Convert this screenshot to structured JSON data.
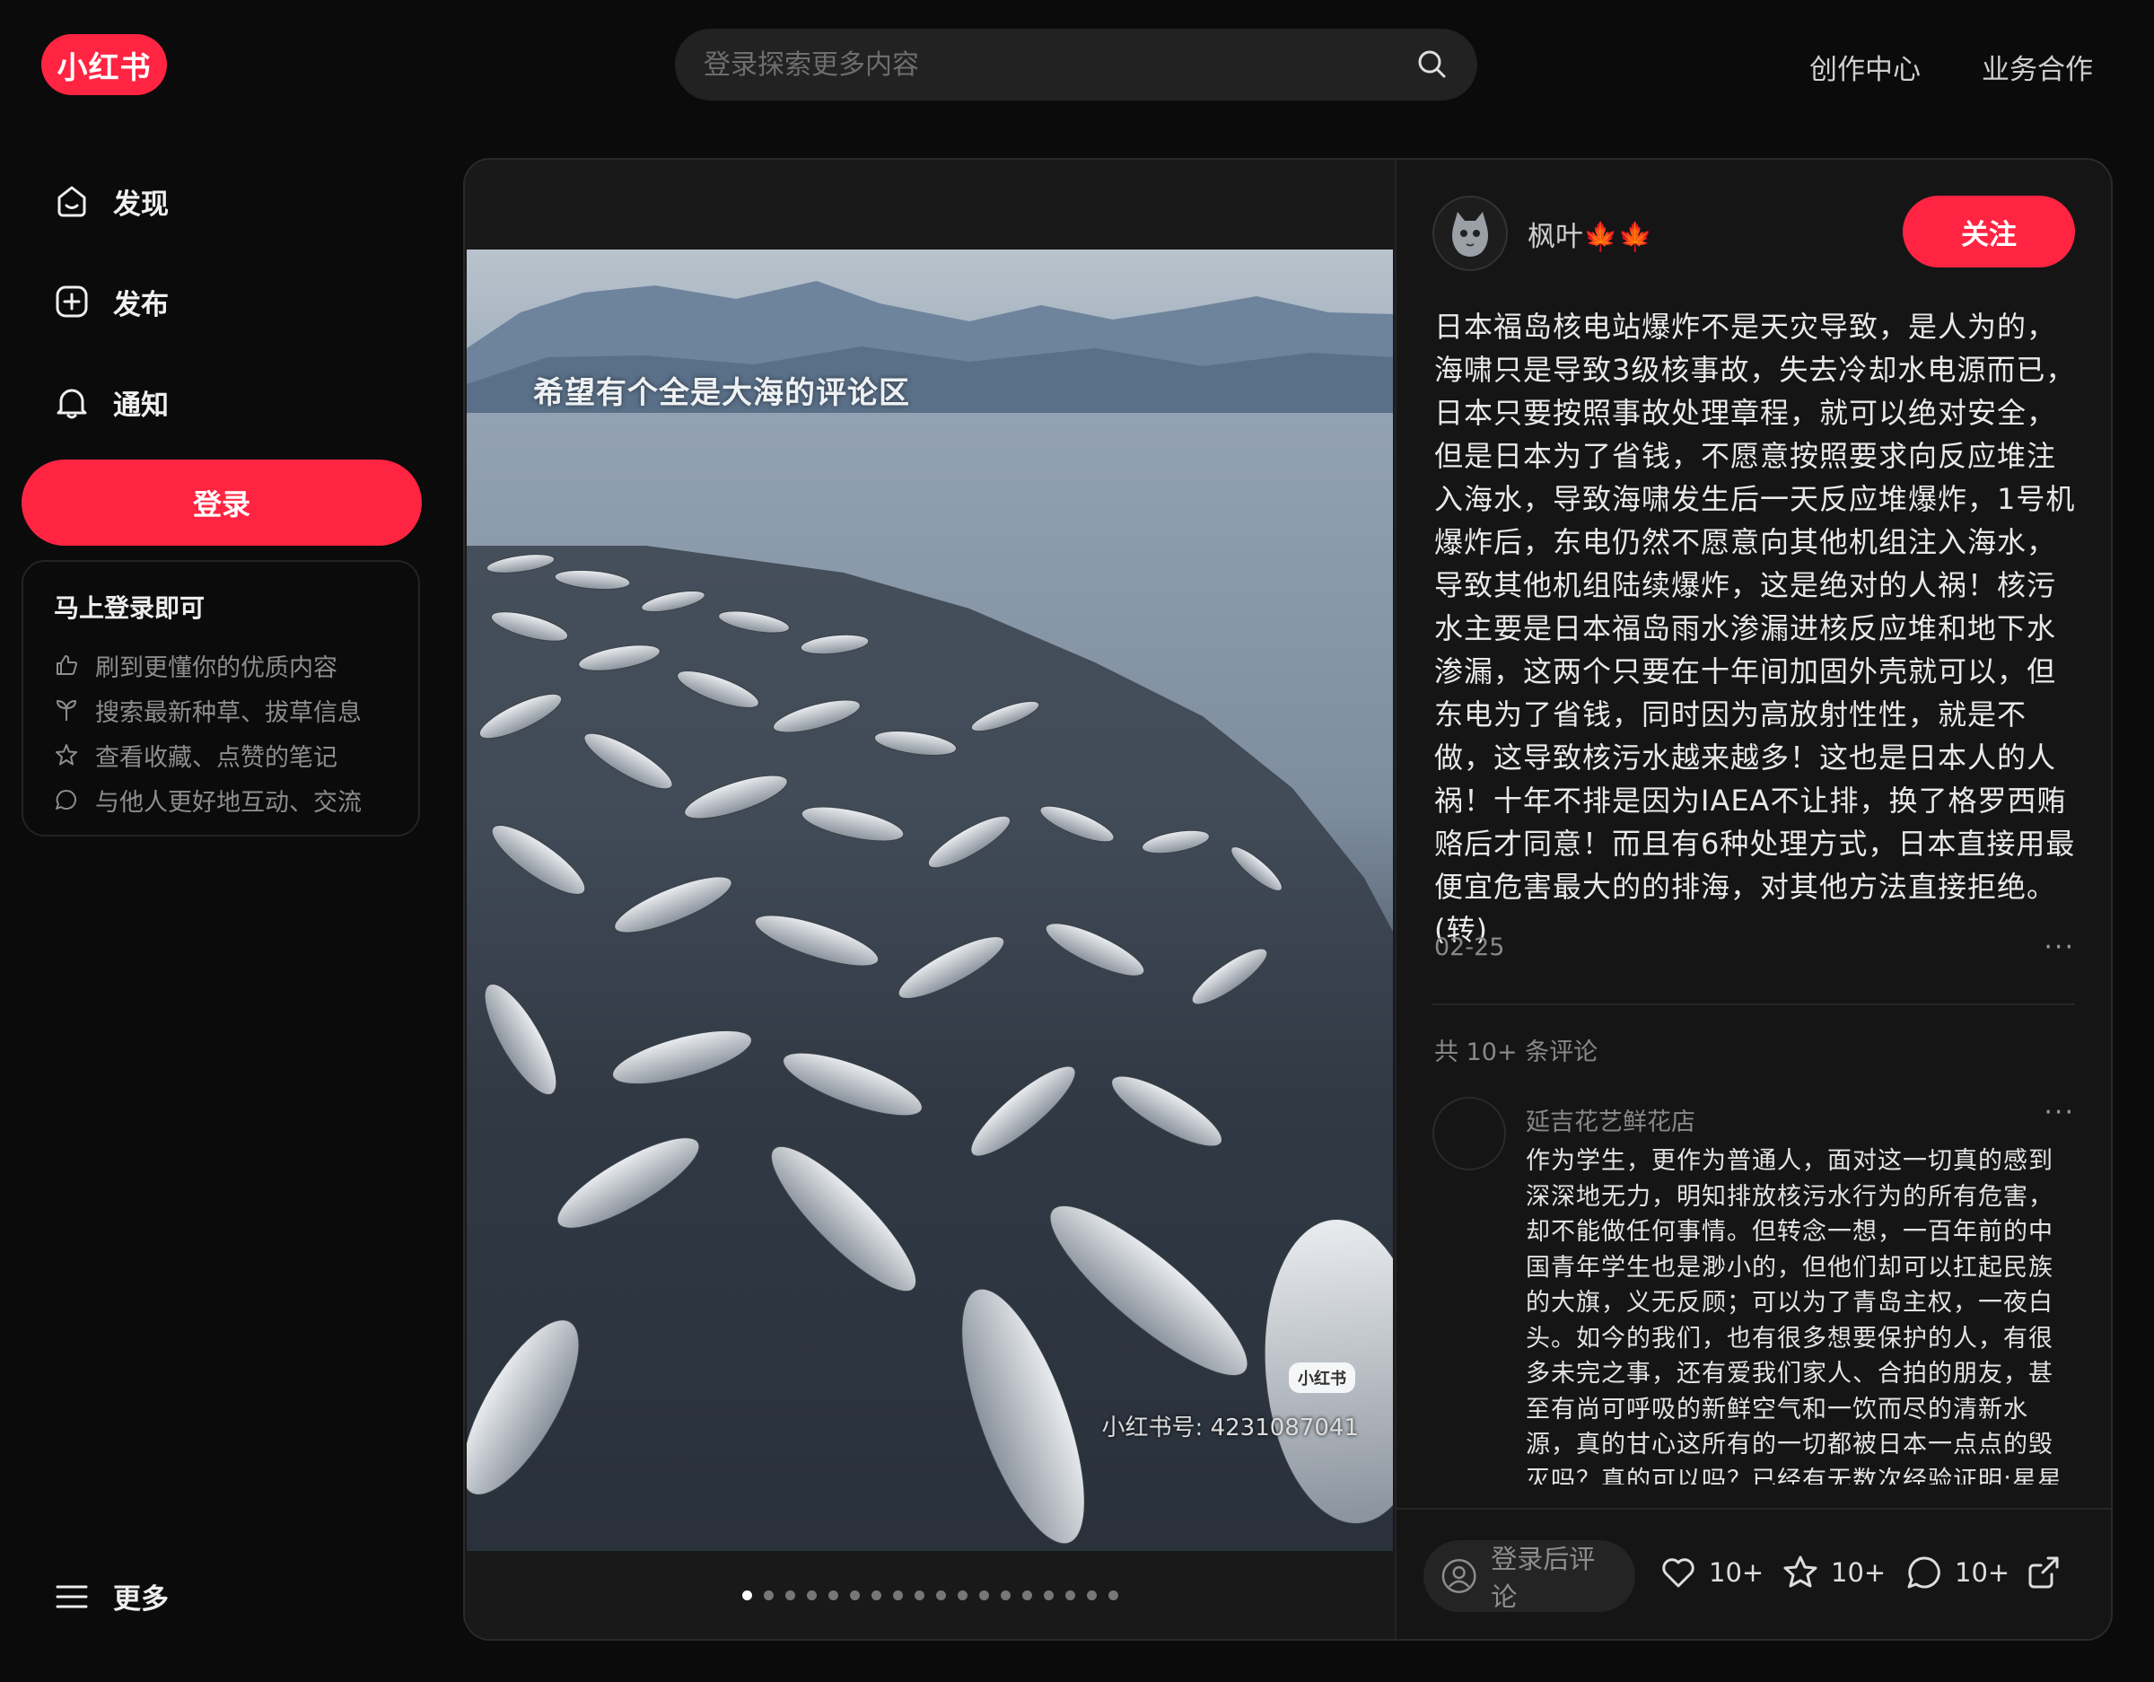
{
  "header": {
    "logo_text": "小红书",
    "search_placeholder": "登录探索更多内容",
    "links": [
      "创作中心",
      "业务合作"
    ]
  },
  "sidebar": {
    "items": [
      {
        "label": "发现",
        "icon": "home-icon"
      },
      {
        "label": "发布",
        "icon": "add-icon"
      },
      {
        "label": "通知",
        "icon": "bell-icon"
      }
    ],
    "login_button": "登录",
    "login_card": {
      "title": "马上登录即可",
      "benefits": [
        {
          "label": "刷到更懂你的优质内容",
          "icon": "thumb-up-icon"
        },
        {
          "label": "搜索最新种草、拔草信息",
          "icon": "sprout-icon"
        },
        {
          "label": "查看收藏、点赞的笔记",
          "icon": "star-icon"
        },
        {
          "label": "与他人更好地互动、交流",
          "icon": "chat-icon"
        }
      ]
    },
    "more_label": "更多"
  },
  "note": {
    "image_caption": "希望有个全是大海的评论区",
    "watermark_logo": "小红书",
    "watermark_id": "小红书号: 4231087041",
    "dots_total": 18,
    "dots_active_index": 0,
    "author": {
      "name": "枫叶🍁🍁"
    },
    "follow_label": "关注",
    "description": "日本福岛核电站爆炸不是天灾导致，是人为的，海啸只是导致3级核事故，失去冷却水电源而已，日本只要按照事故处理章程，就可以绝对安全，但是日本为了省钱，不愿意按照要求向反应堆注入海水，导致海啸发生后一天反应堆爆炸，1号机爆炸后，东电仍然不愿意向其他机组注入海水，导致其他机组陆续爆炸，这是绝对的人祸！核污水主要是日本福岛雨水渗漏进核反应堆和地下水渗漏，这两个只要在十年间加固外壳就可以，但东电为了省钱，同时因为高放射性性，就是不做，这导致核污水越来越多！这也是日本人的人祸！十年不排是因为IAEA不让排，换了格罗西贿赂后才同意！而且有6种处理方式，日本直接用最便宜危害最大的的排海，对其他方法直接拒绝。(转)",
    "date": "02-25",
    "more_dots": "···",
    "comment_count": "共 10+ 条评论",
    "comments": [
      {
        "name": "延吉花艺鲜花店",
        "text": "作为学生，更作为普通人，面对这一切真的感到深深地无力，明知排放核污水行为的所有危害，却不能做任何事情。但转念一想，一百年前的中国青年学生也是渺小的，但他们却可以扛起民族的大旗，义无反顾；可以为了青岛主权，一夜白头。如今的我们，也有很多想要保护的人，有很多未完之事，还有爱我们家人、合拍的朋友，甚至有尚可呼吸的新鲜空气和一饮而尽的清新水源，真的甘心这所有的一切都被日本一点点的毁灭吗？真的可以吗？已经有无数次经验证明:星星之火，可以燎原，相信相信的力量，做自己认为"
      }
    ],
    "comment_placeholder": "登录后评论",
    "actions": {
      "likes": "10+",
      "collects": "10+",
      "comments": "10+"
    }
  },
  "colors": {
    "brand": "#ff2442",
    "background": "#0b0b0b",
    "panel": "#151515"
  }
}
